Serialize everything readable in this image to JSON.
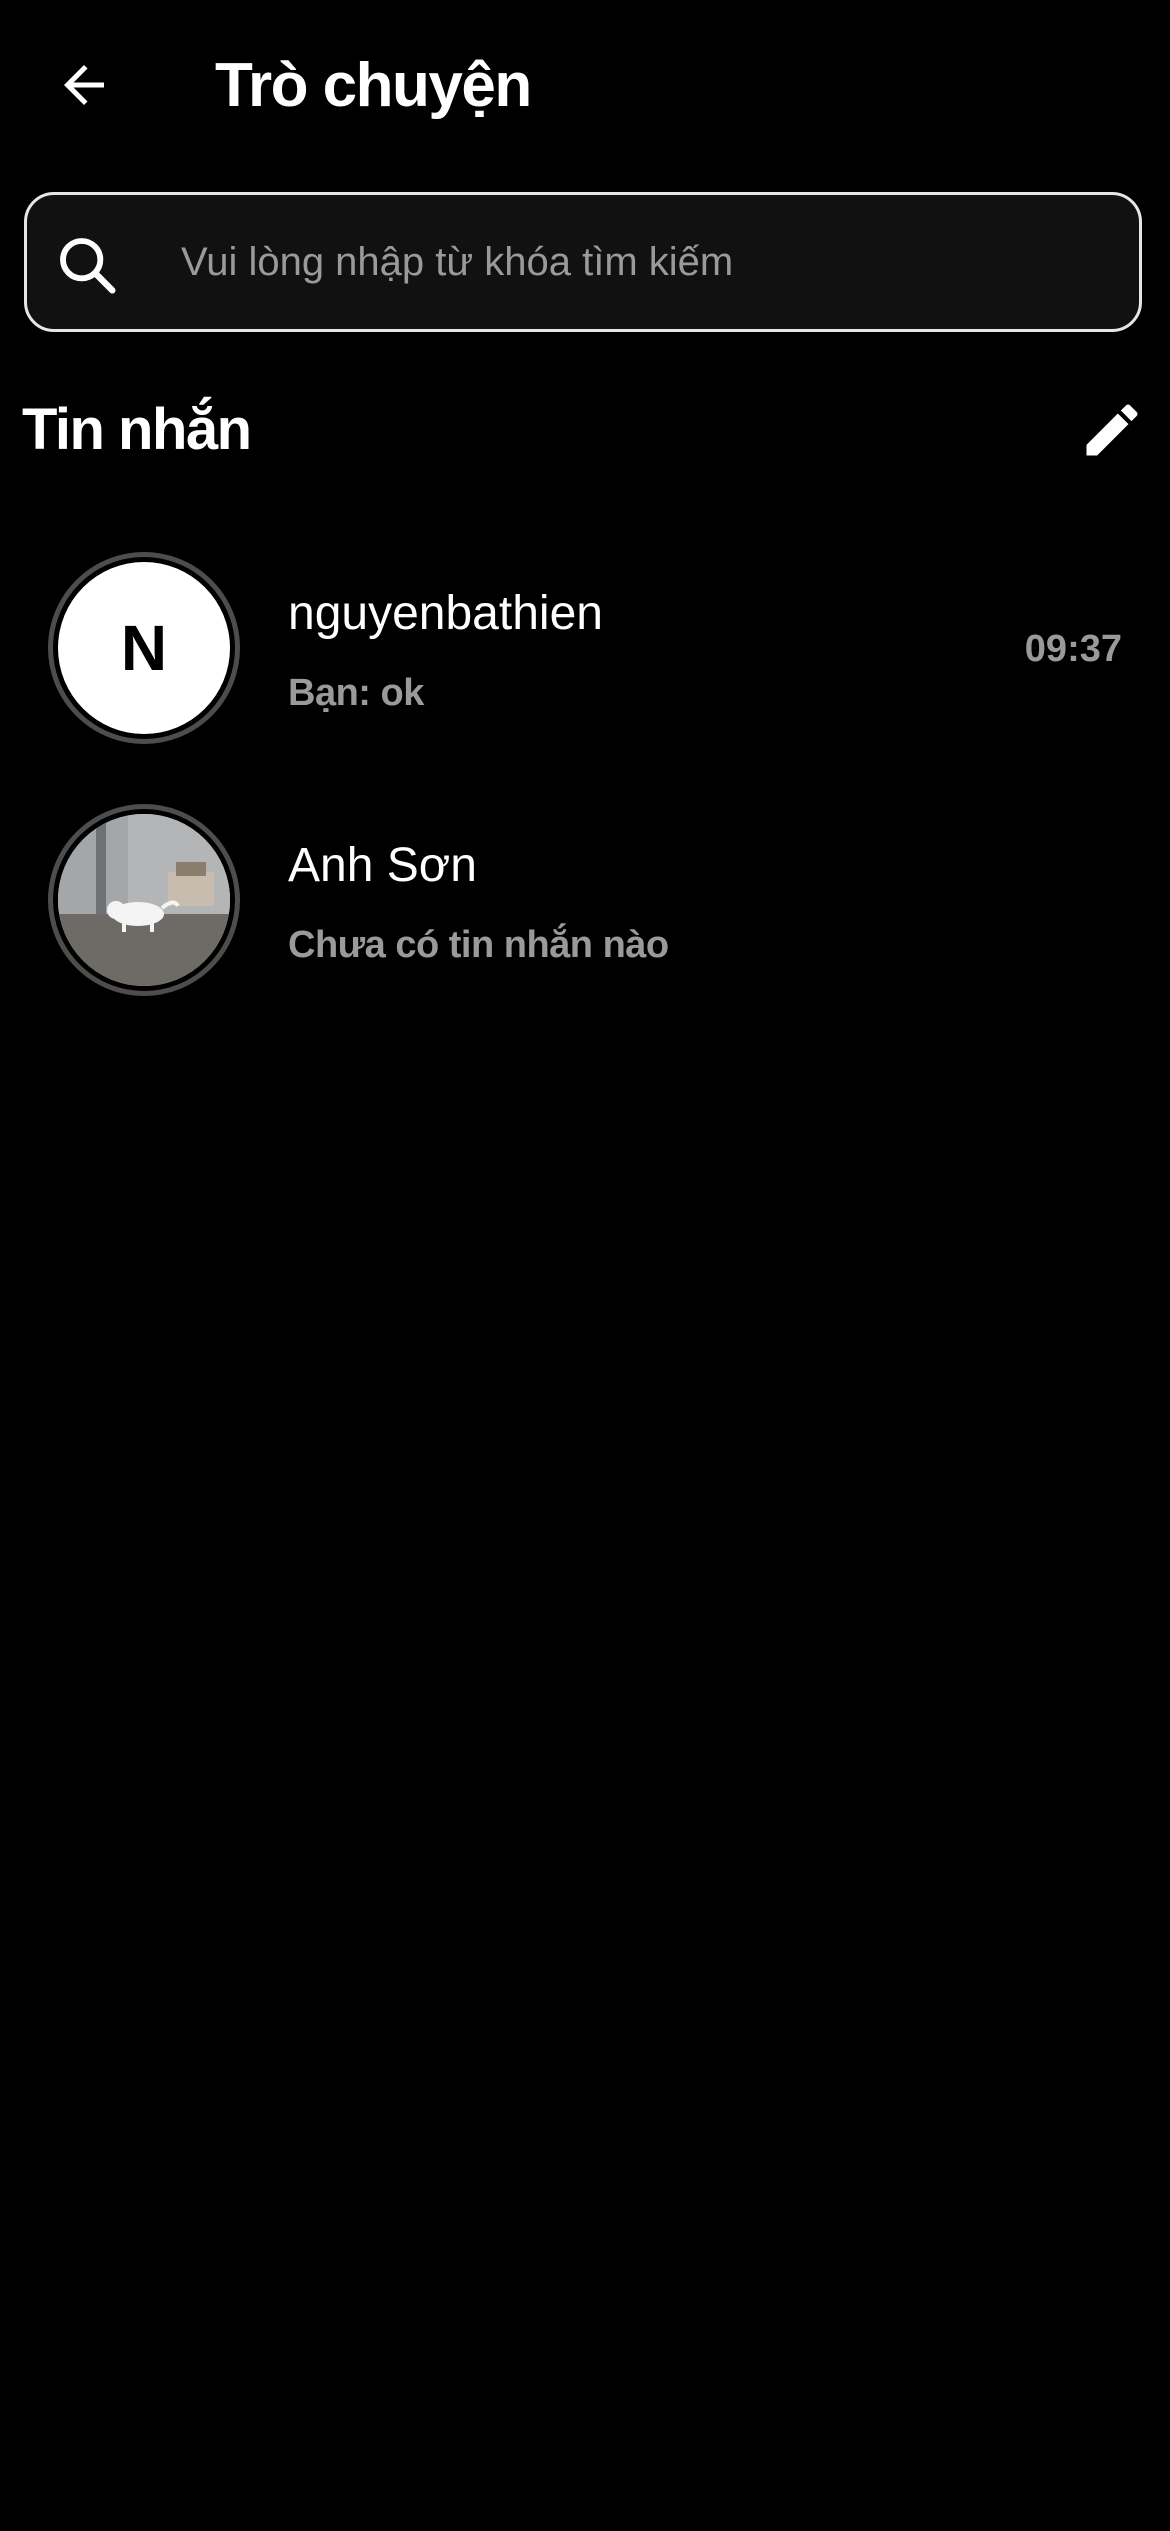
{
  "header": {
    "title": "Trò chuyện",
    "back_icon": "arrow-left-icon"
  },
  "search": {
    "placeholder": "Vui lòng nhập từ khóa tìm kiếm",
    "value": "",
    "icon": "search-icon"
  },
  "messages_section": {
    "title": "Tin nhắn",
    "compose_icon": "pencil-icon"
  },
  "conversations": [
    {
      "name": "nguyenbathien",
      "preview": "Bạn: ok",
      "time": "09:37",
      "avatar_letter": "N",
      "avatar_type": "letter"
    },
    {
      "name": "Anh Sơn",
      "preview": "Chưa có tin nhắn nào",
      "time": "",
      "avatar_type": "photo",
      "avatar_description_icon": "cat-photo-avatar"
    }
  ],
  "colors": {
    "background": "#000000",
    "text_primary": "#ffffff",
    "text_secondary": "#9a9a9a",
    "search_border": "#e6e6e6",
    "avatar_ring": "#4d4d4d"
  }
}
